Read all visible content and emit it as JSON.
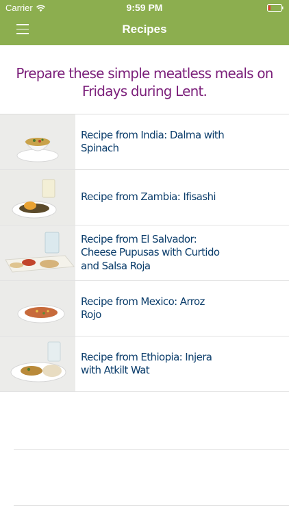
{
  "status_bar": {
    "carrier": "Carrier",
    "time": "9:59 PM",
    "battery_color": "#e53935"
  },
  "nav": {
    "title": "Recipes",
    "bar_color": "#8cae4f"
  },
  "intro_text": "Prepare these simple meatless meals on Fridays during Lent.",
  "recipes": [
    {
      "title": "Recipe from India: Dalma with Spinach",
      "image_icon": "dalma-photo"
    },
    {
      "title": "Recipe from Zambia: Ifisashi",
      "image_icon": "ifisashi-photo"
    },
    {
      "title": "Recipe from El Salvador: Cheese Pupusas with Curtido and Salsa Roja",
      "image_icon": "pupusas-photo"
    },
    {
      "title": "Recipe from Mexico: Arroz Rojo",
      "image_icon": "arroz-rojo-photo"
    },
    {
      "title": "Recipe from Ethiopia: Injera with Atkilt Wat",
      "image_icon": "injera-photo"
    }
  ]
}
